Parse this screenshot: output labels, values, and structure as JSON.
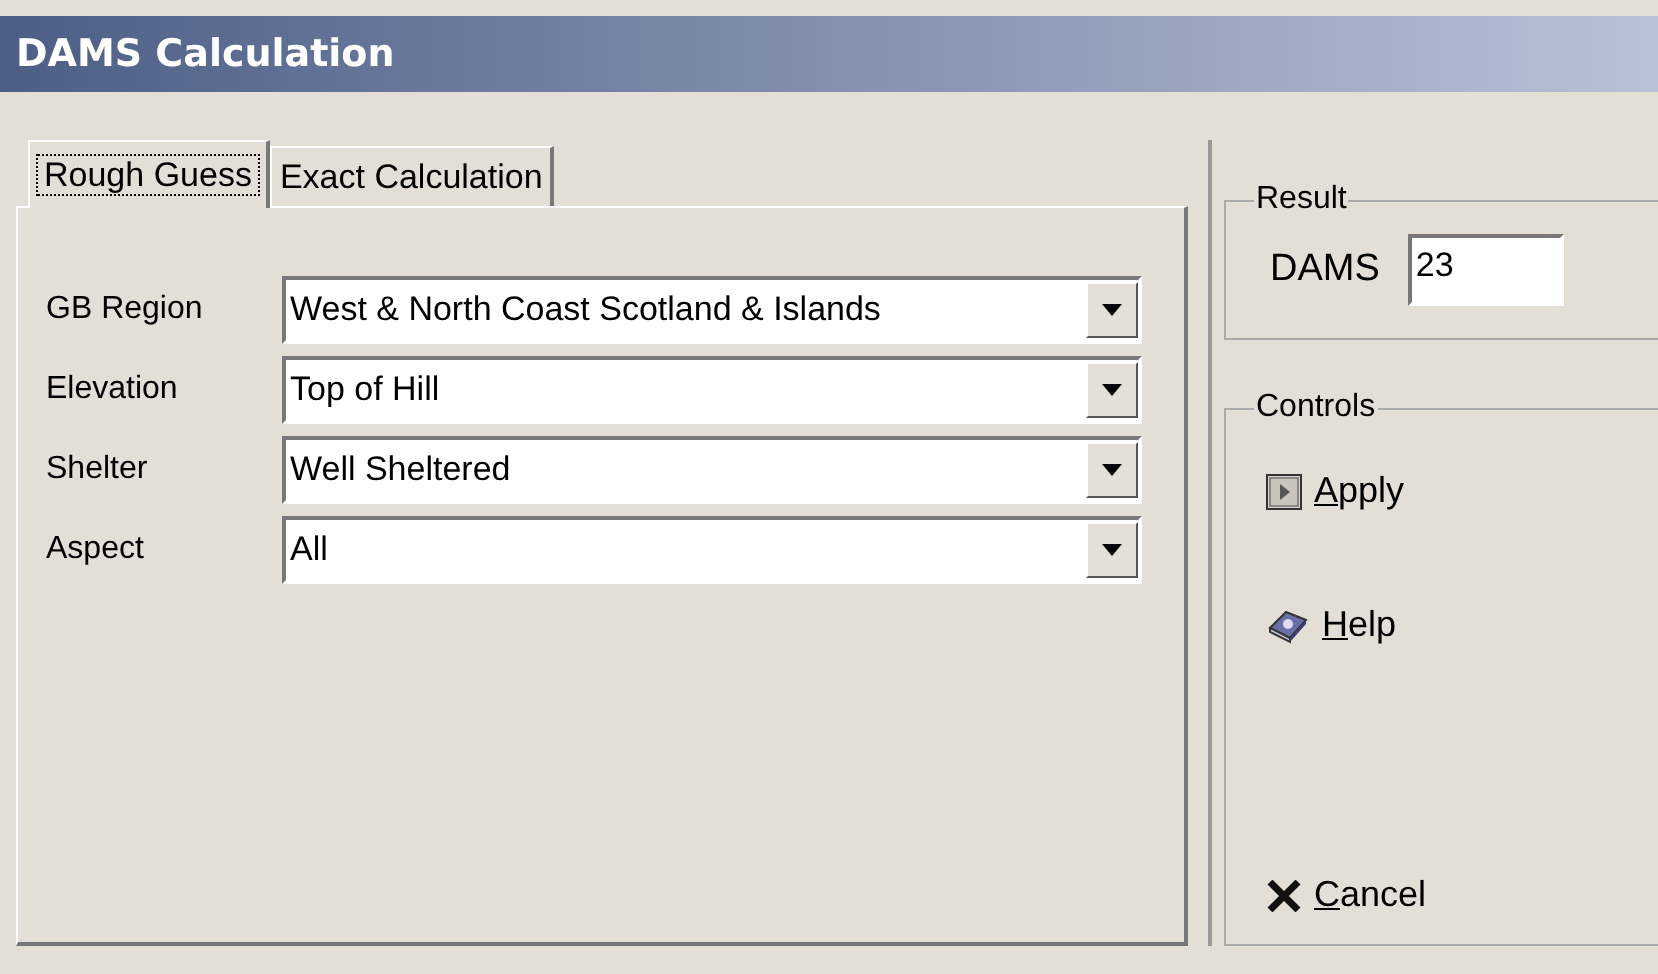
{
  "window": {
    "title": "DAMS Calculation"
  },
  "tabs": [
    {
      "label": "Rough Guess",
      "selected": true
    },
    {
      "label": "Exact Calculation",
      "selected": false
    }
  ],
  "fields": [
    {
      "label": "GB Region",
      "value": "West & North Coast Scotland & Islands"
    },
    {
      "label": "Elevation",
      "value": "Top of Hill"
    },
    {
      "label": "Shelter",
      "value": "Well Sheltered"
    },
    {
      "label": "Aspect",
      "value": "All"
    }
  ],
  "result": {
    "title": "Result",
    "label": "DAMS",
    "value": "23"
  },
  "controls": {
    "title": "Controls",
    "buttons": [
      {
        "label": "Apply",
        "kind": "apply"
      },
      {
        "label": "Help",
        "kind": "help"
      },
      {
        "label": "Cancel",
        "kind": "cancel"
      }
    ]
  }
}
